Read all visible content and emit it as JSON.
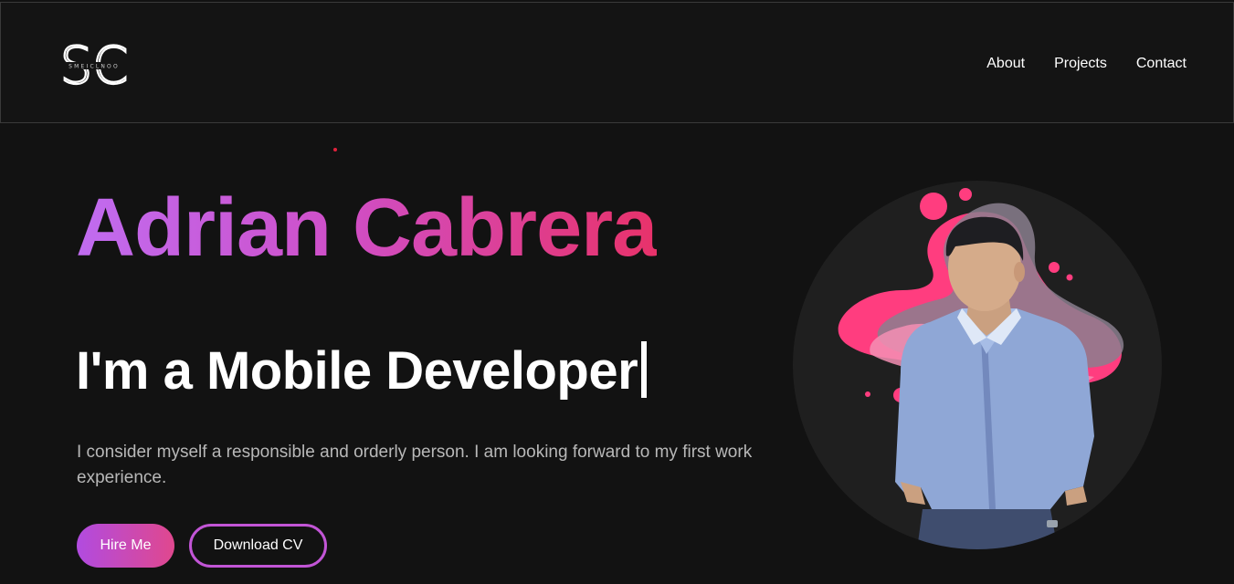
{
  "header": {
    "logo_text": "SC",
    "logo_subtext": "SMEICLNOO",
    "nav": [
      {
        "label": "About"
      },
      {
        "label": "Projects"
      },
      {
        "label": "Contact"
      }
    ]
  },
  "hero": {
    "name": "Adrian Cabrera",
    "role": "I'm a Mobile Developer",
    "description": "I consider myself a responsible and orderly person. I am looking forward to my first work experience.",
    "buttons": {
      "hire": "Hire Me",
      "cv": "Download CV"
    }
  },
  "colors": {
    "background": "#121212",
    "gradient_start": "#c06cf0",
    "gradient_end": "#e8326a",
    "accent_pink": "#ff3d7f",
    "button_border": "#c255d6"
  }
}
